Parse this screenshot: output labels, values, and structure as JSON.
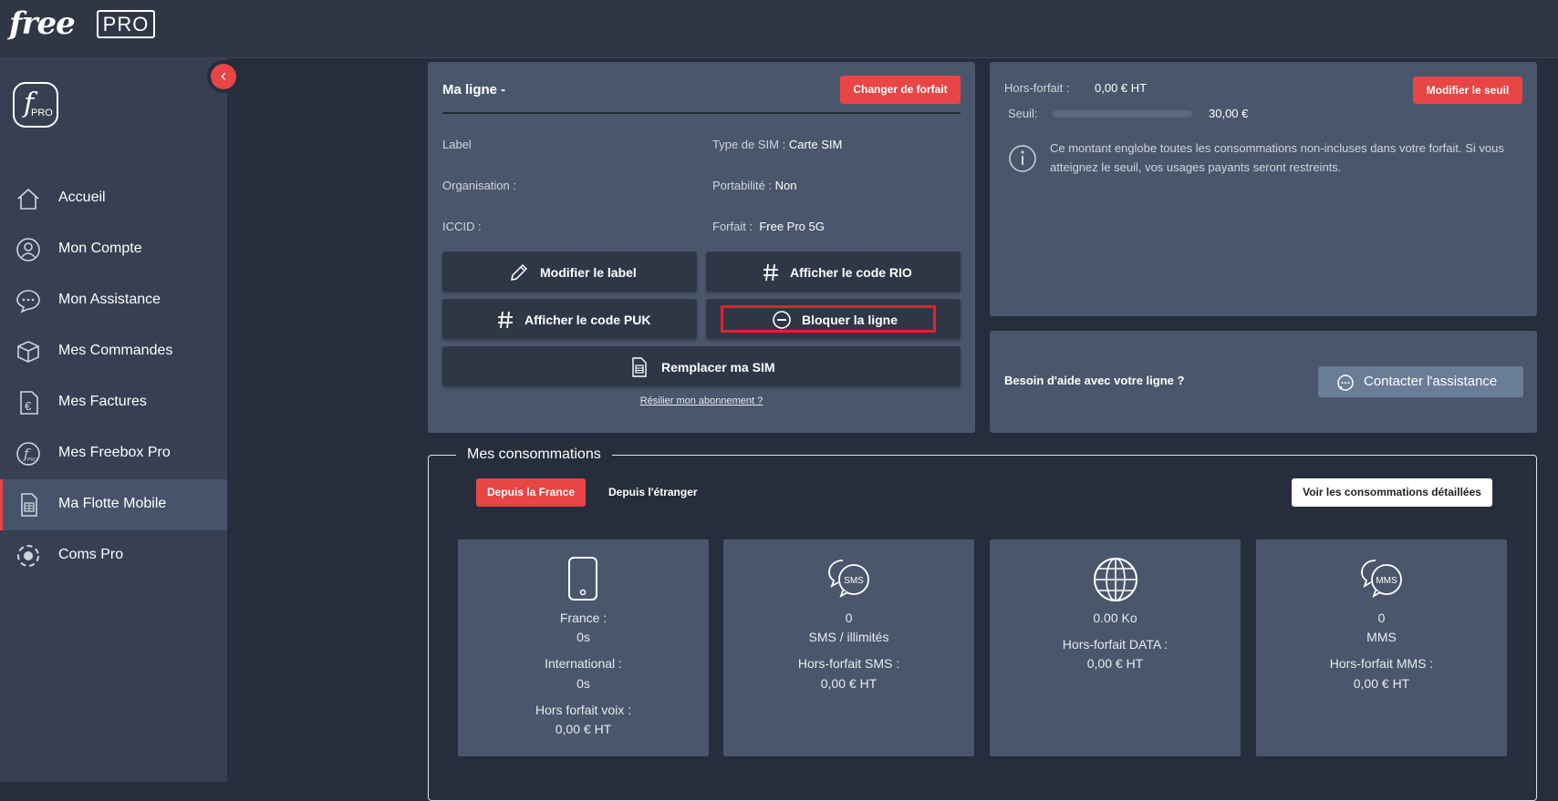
{
  "header": {
    "brand": "free",
    "brand_badge": "PRO"
  },
  "sidebar": {
    "logo_f": "f",
    "logo_pro": "PRO",
    "items": [
      {
        "label": "Accueil",
        "icon": "home-icon",
        "active": false
      },
      {
        "label": "Mon Compte",
        "icon": "user-icon",
        "active": false
      },
      {
        "label": "Mon Assistance",
        "icon": "chat-icon",
        "active": false
      },
      {
        "label": "Mes Commandes",
        "icon": "package-icon",
        "active": false
      },
      {
        "label": "Mes Factures",
        "icon": "euro-document-icon",
        "active": false
      },
      {
        "label": "Mes Freebox Pro",
        "icon": "freebox-icon",
        "active": false
      },
      {
        "label": "Ma Flotte Mobile",
        "icon": "sim-card-icon",
        "active": true
      },
      {
        "label": "Coms Pro",
        "icon": "coms-icon",
        "active": false
      }
    ],
    "collapse_icon": "chevron-left-icon"
  },
  "line_card": {
    "title": "Ma ligne -",
    "change_plan_button": "Changer de forfait",
    "label_label": "Label",
    "organisation_label": "Organisation :",
    "iccid_label": "ICCID :",
    "sim_type_label": "Type de SIM :",
    "sim_type_value": "Carte SIM",
    "portability_label": "Portabilité :",
    "portability_value": "Non",
    "plan_label": "Forfait :",
    "plan_value": "Free Pro 5G",
    "buttons": {
      "edit_label": "Modifier le label",
      "show_rio": "Afficher le code RIO",
      "show_puk": "Afficher le code PUK",
      "block_line": "Bloquer la ligne",
      "replace_sim": "Remplacer ma SIM"
    },
    "cancel_link": "Résilier mon abonnement ?"
  },
  "threshold_card": {
    "overage_label": "Hors-forfait :",
    "overage_value": "0,00 € HT",
    "threshold_label": "Seuil:",
    "threshold_value": "30,00 €",
    "threshold_progress": 0,
    "modify_button": "Modifier le seuil",
    "info_text": "Ce montant englobe toutes les consommations non-incluses dans votre forfait. Si vous atteignez le seuil, vos usages payants seront restreints."
  },
  "help_card": {
    "text": "Besoin d'aide avec votre ligne ?",
    "contact_button": "Contacter l'assistance"
  },
  "consumption": {
    "title": "Mes consommations",
    "tab_france": "Depuis la France",
    "tab_abroad": "Depuis l'étranger",
    "details_button": "Voir les consommations détaillées",
    "voice": {
      "france_label": "France :",
      "france_value": "0s",
      "intl_label": "International :",
      "intl_value": "0s",
      "overage_label": "Hors forfait voix :",
      "overage_value": "0,00 € HT"
    },
    "sms": {
      "count": "0",
      "count_label": "SMS / illimités",
      "overage_label": "Hors-forfait SMS :",
      "overage_value": "0,00 € HT",
      "badge": "SMS"
    },
    "data": {
      "amount": "0.00 Ko",
      "overage_label": "Hors-forfait DATA :",
      "overage_value": "0,00 € HT"
    },
    "mms": {
      "count": "0",
      "count_label": "MMS",
      "overage_label": "Hors-forfait MMS :",
      "overage_value": "0,00 € HT",
      "badge": "MMS"
    }
  },
  "colors": {
    "accent_red": "#e84545",
    "card_bg": "#4a566b",
    "page_bg": "#262e3d",
    "sidebar_bg": "#364052"
  }
}
